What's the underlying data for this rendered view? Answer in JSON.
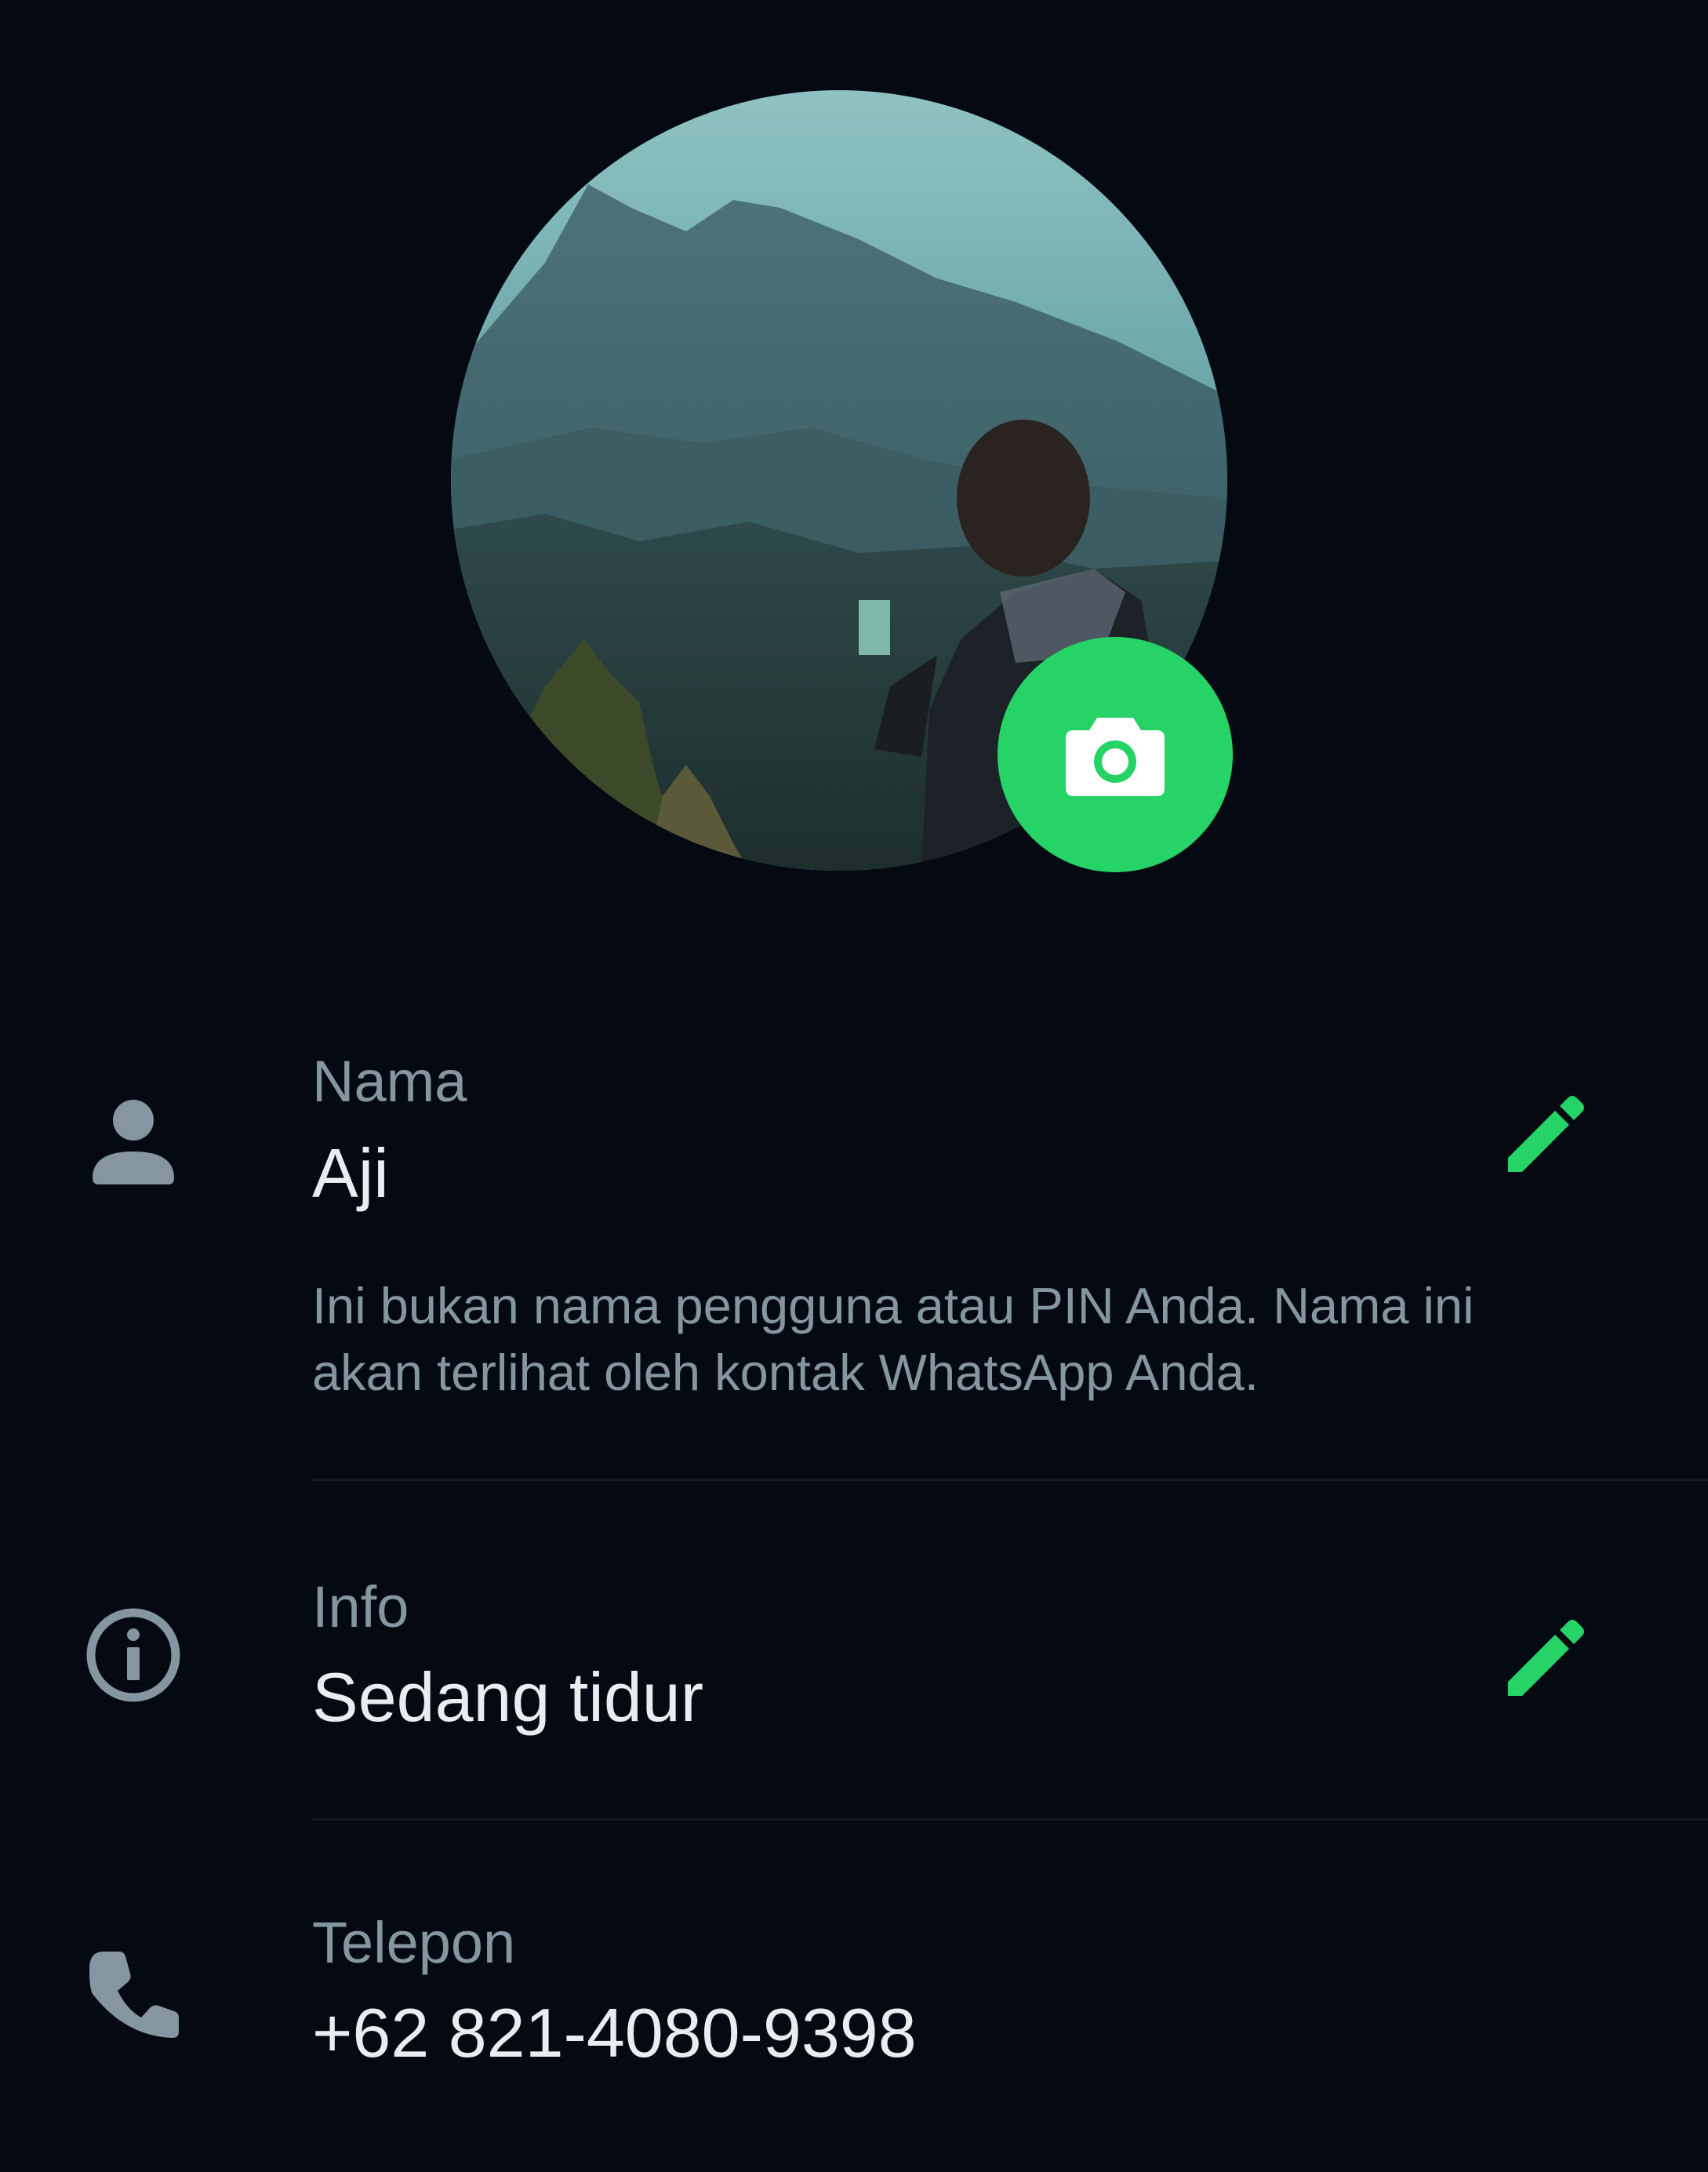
{
  "profile": {
    "photo_icon": "profile-photo",
    "camera_icon": "camera-icon"
  },
  "name": {
    "icon": "person-icon",
    "label": "Nama",
    "value": "Aji",
    "hint": "Ini bukan nama pengguna atau PIN Anda. Nama ini akan terlihat oleh kontak WhatsApp Anda.",
    "edit_icon": "pencil-icon"
  },
  "about": {
    "icon": "info-icon",
    "label": "Info",
    "value": "Sedang tidur",
    "edit_icon": "pencil-icon"
  },
  "phone": {
    "icon": "phone-icon",
    "label": "Telepon",
    "value": "+62 821-4080-9398"
  },
  "colors": {
    "background": "#050a12",
    "accent": "#25d366",
    "label": "#8696a0",
    "text": "#e9edef",
    "icon": "#8696a0"
  }
}
